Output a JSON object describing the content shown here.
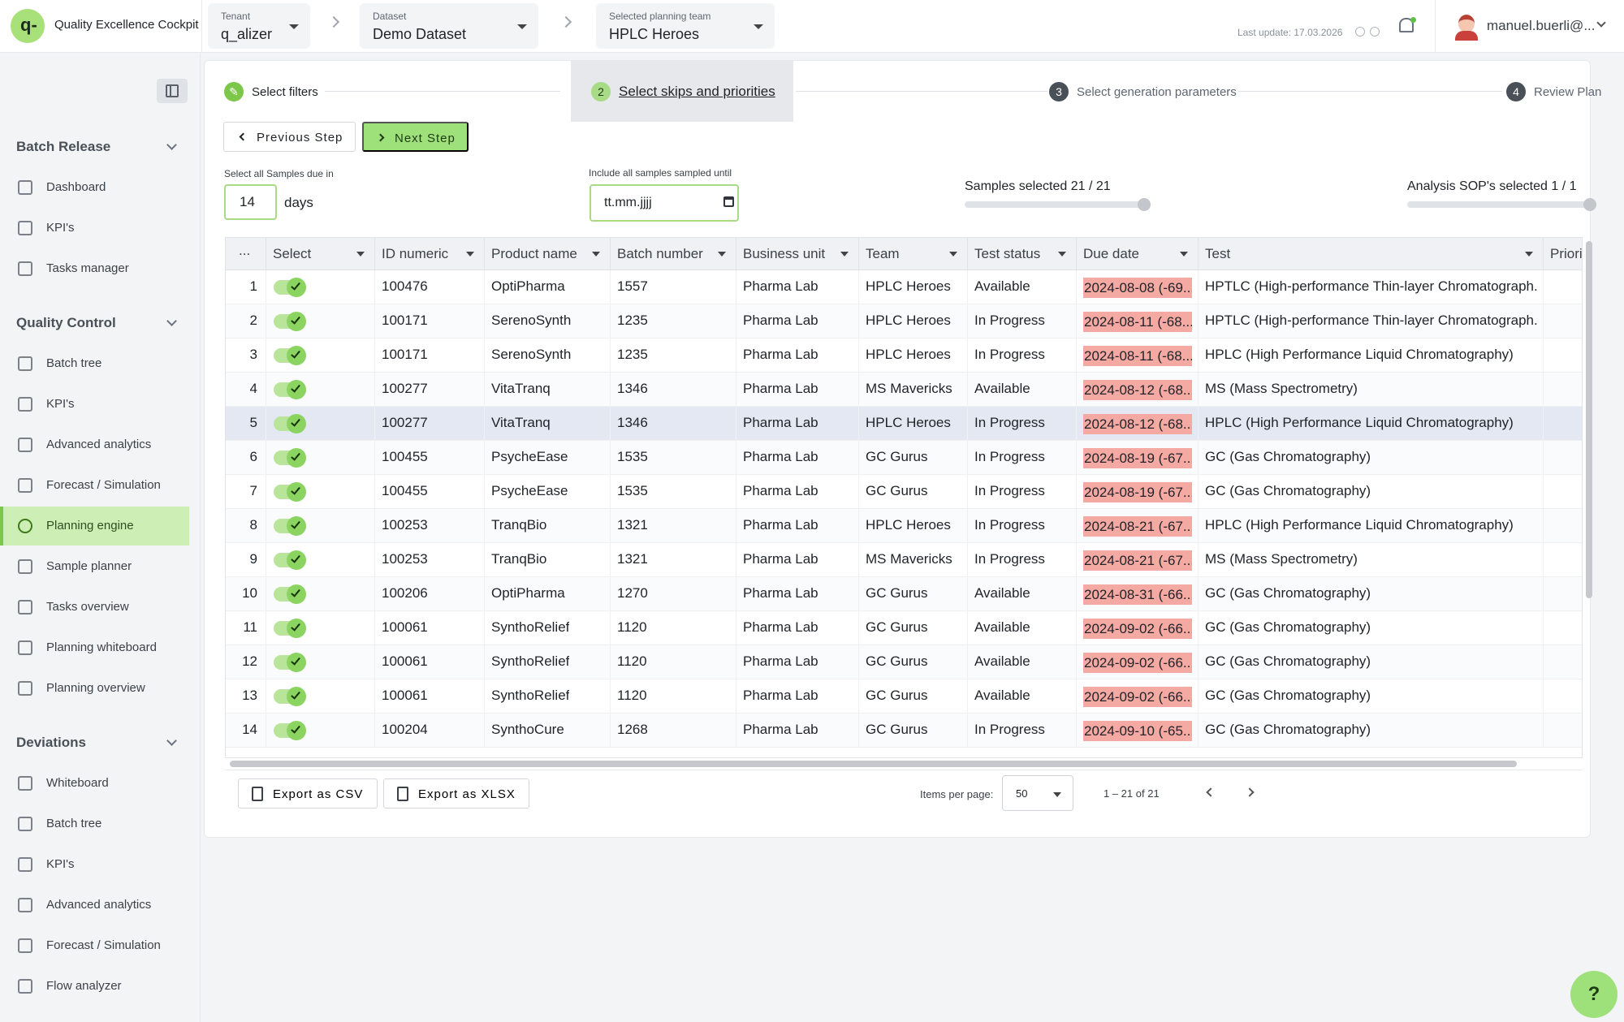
{
  "app": {
    "title": "Quality Excellence Cockpit",
    "logo_text": "q-"
  },
  "header": {
    "tenant": {
      "label": "Tenant",
      "value": "q_alizer"
    },
    "dataset": {
      "label": "Dataset",
      "value": "Demo Dataset"
    },
    "team": {
      "label": "Selected planning team",
      "value": "HPLC Heroes"
    },
    "last_update": "Last update: 17.03.2026",
    "user": "manuel.buerli@..."
  },
  "sidebar": {
    "sections": [
      {
        "title": "Batch Release",
        "items": [
          "Dashboard",
          "KPI's",
          "Tasks manager"
        ]
      },
      {
        "title": "Quality Control",
        "items": [
          "Batch tree",
          "KPI's",
          "Advanced analytics",
          "Forecast / Simulation",
          "Planning engine",
          "Sample planner",
          "Tasks overview",
          "Planning whiteboard",
          "Planning overview"
        ]
      },
      {
        "title": "Deviations",
        "items": [
          "Whiteboard",
          "Batch tree",
          "KPI's",
          "Advanced analytics",
          "Forecast / Simulation",
          "Flow analyzer"
        ]
      }
    ],
    "active_item": "Planning engine"
  },
  "stepper": {
    "steps": [
      {
        "number": "",
        "label": "Select filters"
      },
      {
        "number": "2",
        "label": "Select skips and priorities"
      },
      {
        "number": "3",
        "label": "Select generation parameters"
      },
      {
        "number": "4",
        "label": "Review Plan"
      }
    ],
    "active_step": 2
  },
  "actions": {
    "previous": "Previous Step",
    "next": "Next Step"
  },
  "filters": {
    "due_label": "Select all Samples due in",
    "due_value": "14",
    "due_unit": "days",
    "sampled_label": "Include all samples sampled until",
    "sampled_placeholder": "tt.mm.jjjj"
  },
  "selection": {
    "samples_label": "Samples selected 21 / 21",
    "samples_fraction": 1.0,
    "sops_label": "Analysis SOP's selected 1 / 1",
    "sops_fraction": 1.0
  },
  "table": {
    "columns": [
      "...",
      "Select",
      "ID numeric",
      "Product name",
      "Batch number",
      "Business unit",
      "Team",
      "Test status",
      "Due date",
      "Test",
      "Priorit"
    ],
    "rows": [
      {
        "n": "1",
        "id": "100476",
        "product": "OptiPharma",
        "batch": "1557",
        "unit": "Pharma Lab",
        "team": "HPLC Heroes",
        "status": "Available",
        "due": "2024-08-08 (-69...",
        "test": "HPTLC (High-performance Thin-layer Chromatograph..."
      },
      {
        "n": "2",
        "id": "100171",
        "product": "SerenoSynth",
        "batch": "1235",
        "unit": "Pharma Lab",
        "team": "HPLC Heroes",
        "status": "In Progress",
        "due": "2024-08-11 (-68...",
        "test": "HPTLC (High-performance Thin-layer Chromatograph..."
      },
      {
        "n": "3",
        "id": "100171",
        "product": "SerenoSynth",
        "batch": "1235",
        "unit": "Pharma Lab",
        "team": "HPLC Heroes",
        "status": "In Progress",
        "due": "2024-08-11 (-68...",
        "test": "HPLC (High Performance Liquid Chromatography)"
      },
      {
        "n": "4",
        "id": "100277",
        "product": "VitaTranq",
        "batch": "1346",
        "unit": "Pharma Lab",
        "team": "MS Mavericks",
        "status": "Available",
        "due": "2024-08-12 (-68...",
        "test": "MS (Mass Spectrometry)"
      },
      {
        "n": "5",
        "id": "100277",
        "product": "VitaTranq",
        "batch": "1346",
        "unit": "Pharma Lab",
        "team": "HPLC Heroes",
        "status": "In Progress",
        "due": "2024-08-12 (-68...",
        "test": "HPLC (High Performance Liquid Chromatography)"
      },
      {
        "n": "6",
        "id": "100455",
        "product": "PsycheEase",
        "batch": "1535",
        "unit": "Pharma Lab",
        "team": "GC Gurus",
        "status": "In Progress",
        "due": "2024-08-19 (-67...",
        "test": "GC (Gas Chromatography)"
      },
      {
        "n": "7",
        "id": "100455",
        "product": "PsycheEase",
        "batch": "1535",
        "unit": "Pharma Lab",
        "team": "GC Gurus",
        "status": "In Progress",
        "due": "2024-08-19 (-67...",
        "test": "GC (Gas Chromatography)"
      },
      {
        "n": "8",
        "id": "100253",
        "product": "TranqBio",
        "batch": "1321",
        "unit": "Pharma Lab",
        "team": "HPLC Heroes",
        "status": "In Progress",
        "due": "2024-08-21 (-67...",
        "test": "HPLC (High Performance Liquid Chromatography)"
      },
      {
        "n": "9",
        "id": "100253",
        "product": "TranqBio",
        "batch": "1321",
        "unit": "Pharma Lab",
        "team": "MS Mavericks",
        "status": "In Progress",
        "due": "2024-08-21 (-67...",
        "test": "MS (Mass Spectrometry)"
      },
      {
        "n": "10",
        "id": "100206",
        "product": "OptiPharma",
        "batch": "1270",
        "unit": "Pharma Lab",
        "team": "GC Gurus",
        "status": "Available",
        "due": "2024-08-31 (-66...",
        "test": "GC (Gas Chromatography)"
      },
      {
        "n": "11",
        "id": "100061",
        "product": "SynthoRelief",
        "batch": "1120",
        "unit": "Pharma Lab",
        "team": "GC Gurus",
        "status": "Available",
        "due": "2024-09-02 (-66...",
        "test": "GC (Gas Chromatography)"
      },
      {
        "n": "12",
        "id": "100061",
        "product": "SynthoRelief",
        "batch": "1120",
        "unit": "Pharma Lab",
        "team": "GC Gurus",
        "status": "Available",
        "due": "2024-09-02 (-66...",
        "test": "GC (Gas Chromatography)"
      },
      {
        "n": "13",
        "id": "100061",
        "product": "SynthoRelief",
        "batch": "1120",
        "unit": "Pharma Lab",
        "team": "GC Gurus",
        "status": "Available",
        "due": "2024-09-02 (-66...",
        "test": "GC (Gas Chromatography)"
      },
      {
        "n": "14",
        "id": "100204",
        "product": "SynthoCure",
        "batch": "1268",
        "unit": "Pharma Lab",
        "team": "GC Gurus",
        "status": "In Progress",
        "due": "2024-09-10 (-65...",
        "test": "GC (Gas Chromatography)"
      }
    ],
    "highlighted_row": 5
  },
  "footer": {
    "export_csv": "Export as CSV",
    "export_xlsx": "Export as XLSX",
    "items_per_page_label": "Items per page:",
    "items_per_page": "50",
    "range": "1 – 21 of 21"
  },
  "help": "?",
  "colors": {
    "accent": "#9ee07a",
    "overdue": "#f5a9a3",
    "active_nav": "#cdeeb4"
  }
}
